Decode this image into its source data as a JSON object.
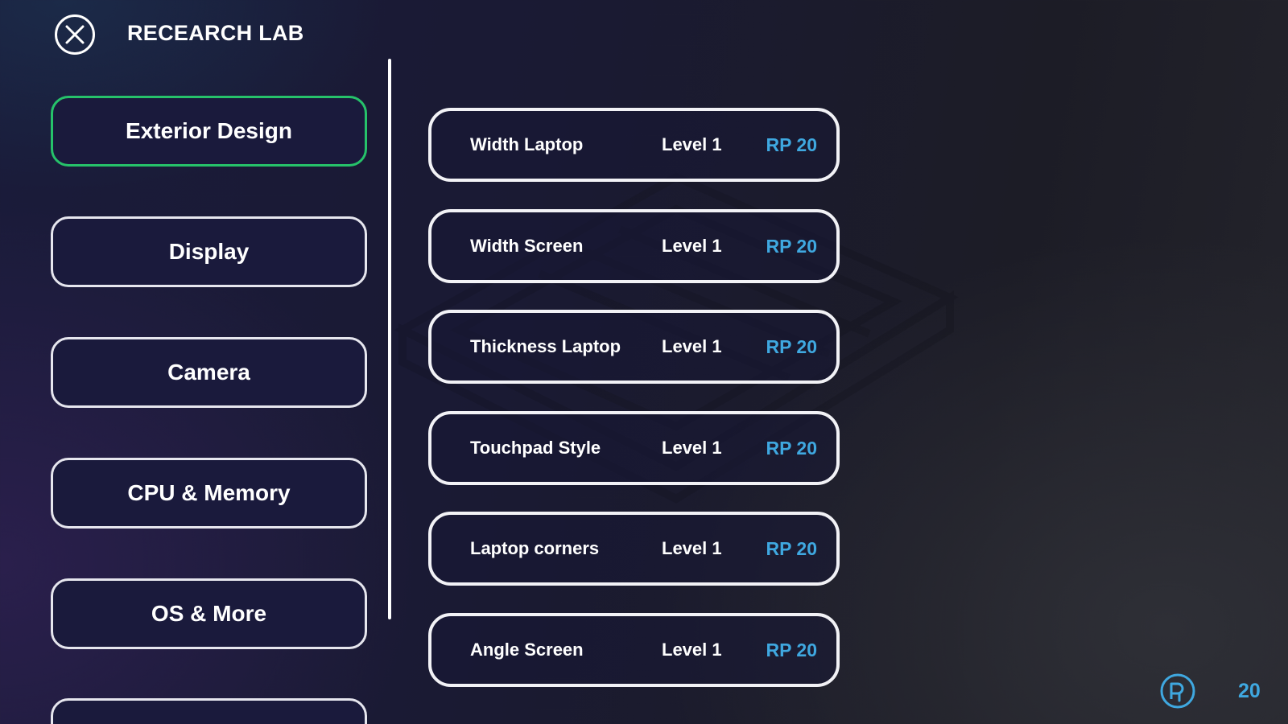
{
  "header": {
    "title": "RECEARCH LAB"
  },
  "categories": [
    {
      "label": "Exterior Design",
      "active": true
    },
    {
      "label": "Display",
      "active": false
    },
    {
      "label": "Camera",
      "active": false
    },
    {
      "label": "CPU & Memory",
      "active": false
    },
    {
      "label": "OS & More",
      "active": false
    }
  ],
  "research_items": [
    {
      "name": "Width Laptop",
      "level": "Level 1",
      "cost": "RP 20"
    },
    {
      "name": "Width Screen",
      "level": "Level 1",
      "cost": "RP 20"
    },
    {
      "name": "Thickness Laptop",
      "level": "Level 1",
      "cost": "RP 20"
    },
    {
      "name": "Touchpad Style",
      "level": "Level 1",
      "cost": "RP 20"
    },
    {
      "name": "Laptop corners",
      "level": "Level 1",
      "cost": "RP 20"
    },
    {
      "name": "Angle Screen",
      "level": "Level 1",
      "cost": "RP 20"
    }
  ],
  "footer": {
    "rp_balance": "20"
  },
  "colors": {
    "active_border": "#26c26a",
    "rp_accent": "#3fa8e0",
    "button_border": "#e6e6ee"
  },
  "icons": {
    "close": "close-icon",
    "rp": "research-points-icon"
  }
}
